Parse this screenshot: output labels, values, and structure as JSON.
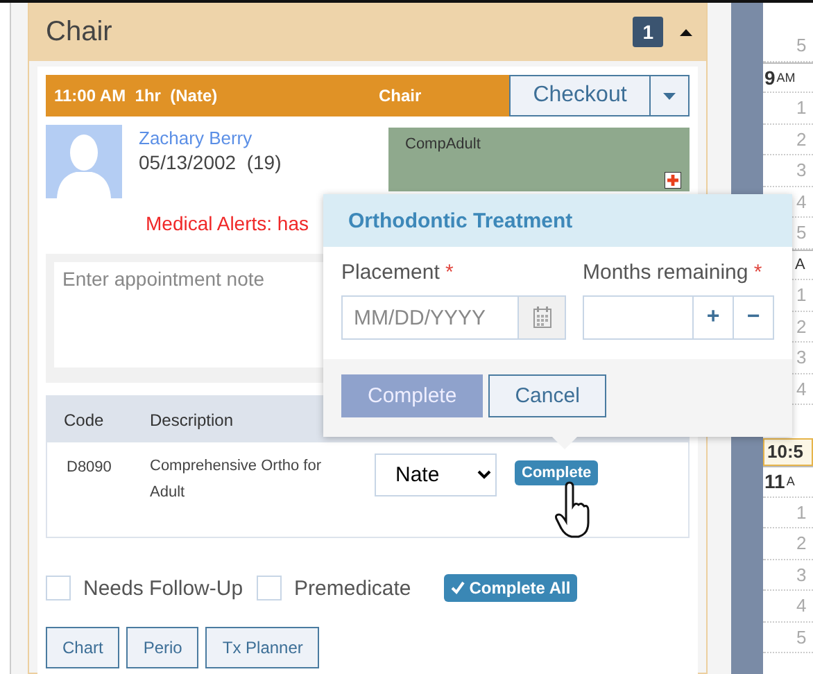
{
  "panel": {
    "title": "Chair",
    "count": "1"
  },
  "appointment": {
    "time": "11:00 AM",
    "duration": "1hr",
    "provider": "(Nate)",
    "chair": "Chair",
    "action": "Checkout"
  },
  "patient": {
    "name": "Zachary Berry",
    "dob": "05/13/2002",
    "age": "(19)",
    "medical_alert": "Medical Alerts: has",
    "tag": "CompAdult"
  },
  "note": {
    "placeholder": "Enter appointment note"
  },
  "procedures": {
    "columns": [
      "Code",
      "Description"
    ],
    "rows": [
      {
        "code": "D8090",
        "description": "Comprehensive Ortho for Adult",
        "provider": "Nate",
        "action": "Complete"
      }
    ]
  },
  "options": [
    {
      "label": "Needs Follow-Up",
      "checked": false
    },
    {
      "label": "Premedicate",
      "checked": false
    }
  ],
  "complete_all": "Complete All",
  "links": [
    "Chart",
    "Perio",
    "Tx Planner"
  ],
  "popover": {
    "title": "Orthodontic Treatment",
    "fields": [
      {
        "kind": "date",
        "label": "Placement",
        "required_mark": "*",
        "placeholder": "MM/DD/YYYY"
      },
      {
        "kind": "stepper",
        "label": "Months remaining",
        "required_mark": "*",
        "increment": "+",
        "decrement": "−"
      }
    ],
    "buttons": [
      {
        "label": "Complete",
        "disabled": true
      },
      {
        "label": "Cancel",
        "disabled": false
      }
    ]
  },
  "schedule": {
    "slots": [
      {
        "kind": "minor",
        "label": "5"
      },
      {
        "kind": "hour",
        "label": "9",
        "suffix": "AM"
      },
      {
        "kind": "minor",
        "label": "1"
      },
      {
        "kind": "minor",
        "label": "2"
      },
      {
        "kind": "minor",
        "label": "3"
      },
      {
        "kind": "minor",
        "label": "4"
      },
      {
        "kind": "minor",
        "label": "5"
      },
      {
        "kind": "hour_partial",
        "label": "A"
      },
      {
        "kind": "minor",
        "label": "1"
      },
      {
        "kind": "minor",
        "label": "2"
      },
      {
        "kind": "minor",
        "label": "3"
      },
      {
        "kind": "minor",
        "label": "4"
      },
      {
        "kind": "current",
        "label": "10:5"
      },
      {
        "kind": "hour",
        "label": "11",
        "suffix": "A"
      },
      {
        "kind": "minor",
        "label": "1"
      },
      {
        "kind": "minor",
        "label": "2"
      },
      {
        "kind": "minor",
        "label": "3"
      },
      {
        "kind": "minor",
        "label": "4"
      },
      {
        "kind": "minor",
        "label": "5"
      }
    ]
  }
}
